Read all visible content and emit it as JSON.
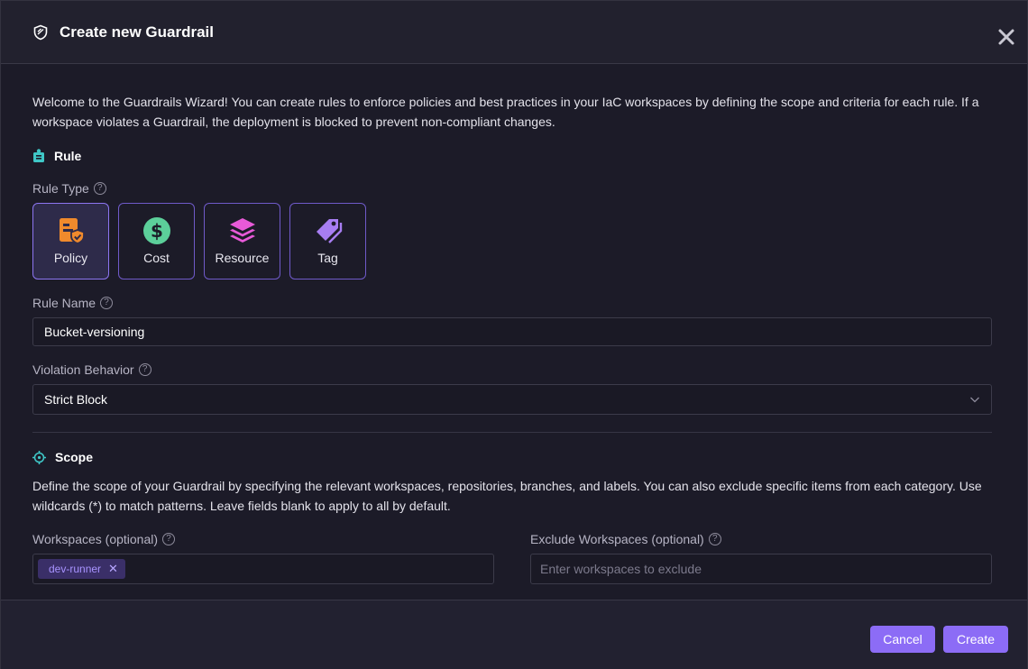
{
  "dialog": {
    "title": "Create new Guardrail",
    "intro": "Welcome to the Guardrails Wizard! You can create rules to enforce policies and best practices in your IaC workspaces by defining the scope and criteria for each rule. If a workspace violates a Guardrail, the deployment is blocked to prevent non-compliant changes."
  },
  "rule": {
    "heading": "Rule",
    "type_label": "Rule Type",
    "types": [
      {
        "label": "Policy",
        "icon": "policy-icon",
        "selected": true
      },
      {
        "label": "Cost",
        "icon": "dollar-icon",
        "selected": false
      },
      {
        "label": "Resource",
        "icon": "layers-icon",
        "selected": false
      },
      {
        "label": "Tag",
        "icon": "tag-icon",
        "selected": false
      }
    ],
    "name_label": "Rule Name",
    "name_value": "Bucket-versioning",
    "violation_label": "Violation Behavior",
    "violation_value": "Strict Block"
  },
  "scope": {
    "heading": "Scope",
    "description": "Define the scope of your Guardrail by specifying the relevant workspaces, repositories, branches, and labels. You can also exclude specific items from each category. Use wildcards (*) to match patterns. Leave fields blank to apply to all by default.",
    "workspaces_label": "Workspaces (optional)",
    "workspaces_chips": [
      "dev-runner"
    ],
    "exclude_label": "Exclude Workspaces (optional)",
    "exclude_placeholder": "Enter workspaces to exclude"
  },
  "footer": {
    "cancel_label": "Cancel",
    "create_label": "Create"
  },
  "colors": {
    "accent": "#8c6cf6",
    "policy_icon": "#f08a2c",
    "cost_icon": "#5ccf9a",
    "resource_icon": "#e85ad8",
    "tag_icon": "#a77ef2",
    "section_icon": "#3fc7c7"
  }
}
